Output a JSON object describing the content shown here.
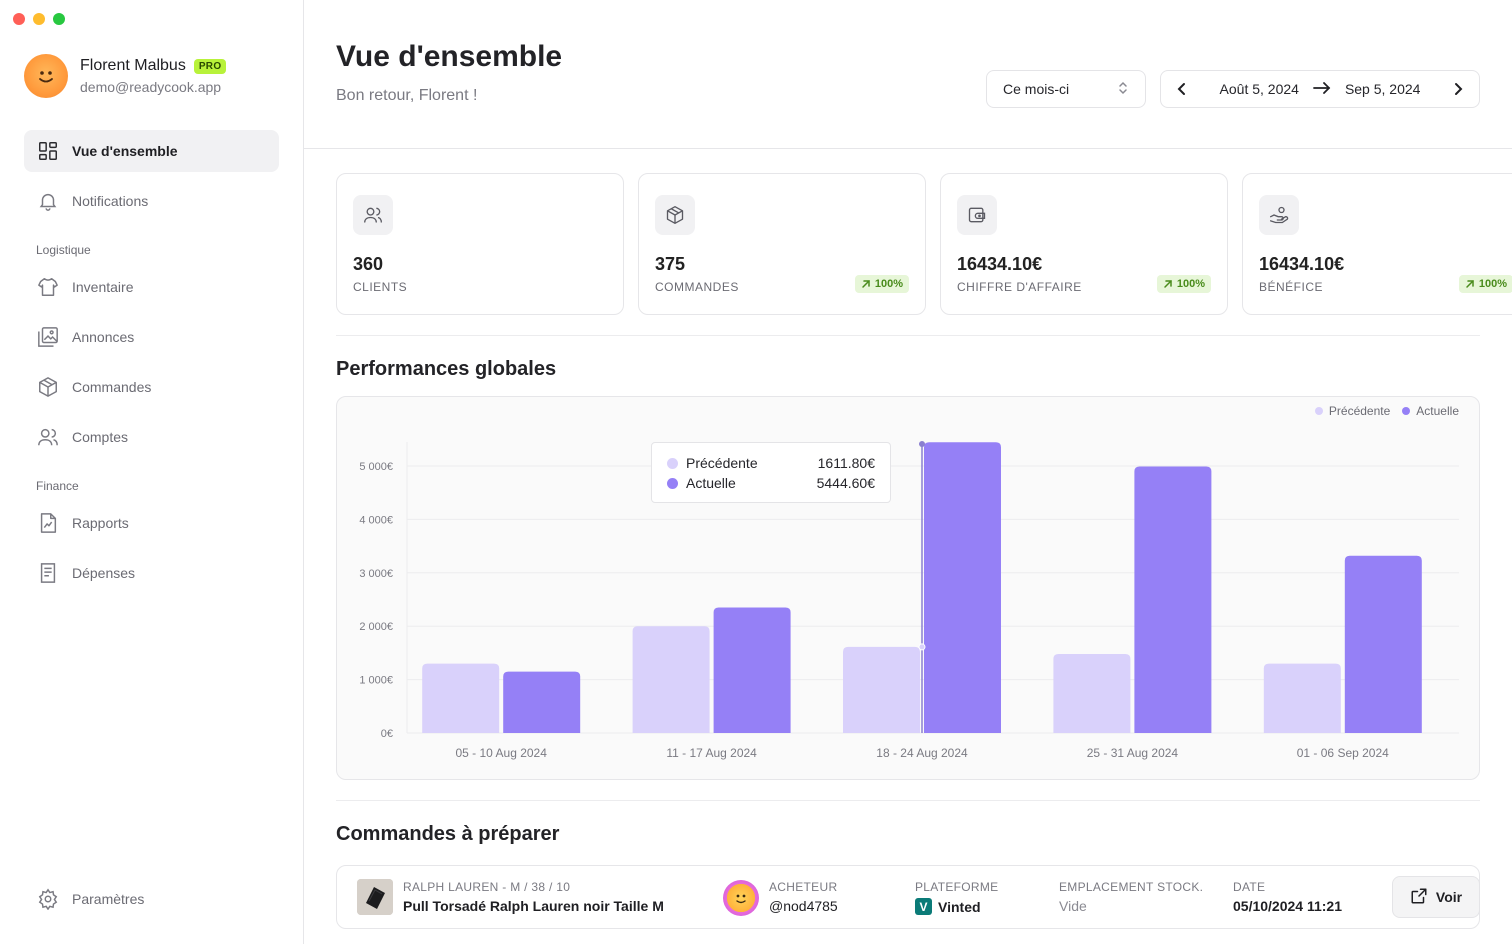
{
  "user": {
    "name": "Florent Malbus",
    "badge": "PRO",
    "email": "demo@readycook.app"
  },
  "sidebar": {
    "main_items": [
      {
        "label": "Vue d'ensemble",
        "icon": "grid-icon",
        "active": true
      },
      {
        "label": "Notifications",
        "icon": "bell-icon"
      }
    ],
    "logistique_label": "Logistique",
    "logistique_items": [
      {
        "label": "Inventaire",
        "icon": "shirt-icon"
      },
      {
        "label": "Annonces",
        "icon": "images-icon"
      },
      {
        "label": "Commandes",
        "icon": "box-icon"
      },
      {
        "label": "Comptes",
        "icon": "users-icon"
      }
    ],
    "finance_label": "Finance",
    "finance_items": [
      {
        "label": "Rapports",
        "icon": "report-icon"
      },
      {
        "label": "Dépenses",
        "icon": "receipt-icon"
      }
    ],
    "settings": {
      "label": "Paramètres",
      "icon": "gear-icon"
    }
  },
  "header": {
    "title": "Vue d'ensemble",
    "subtitle": "Bon retour, Florent !",
    "period_select": "Ce mois-ci",
    "date_start": "Août 5, 2024",
    "date_end": "Sep 5, 2024"
  },
  "stats": [
    {
      "value": "360",
      "label": "CLIENTS",
      "icon": "users-icon",
      "delta": ""
    },
    {
      "value": "375",
      "label": "COMMANDES",
      "icon": "box-icon",
      "delta": "100%"
    },
    {
      "value": "16434.10€",
      "label": "CHIFFRE D'AFFAIRE",
      "icon": "wallet-icon",
      "delta": "100%"
    },
    {
      "value": "16434.10€",
      "label": "BÉNÉFICE",
      "icon": "hand-coin-icon",
      "delta": "100%"
    }
  ],
  "performance": {
    "title": "Performances globales",
    "legend": {
      "previous": "Précédente",
      "current": "Actuelle"
    },
    "tooltip": {
      "previous_label": "Précédente",
      "previous_value": "1611.80€",
      "current_label": "Actuelle",
      "current_value": "5444.60€"
    }
  },
  "chart_data": {
    "type": "bar",
    "categories": [
      "05 - 10 Aug 2024",
      "11 - 17 Aug 2024",
      "18 - 24 Aug 2024",
      "25 - 31 Aug 2024",
      "01 - 06 Sep 2024"
    ],
    "series": [
      {
        "name": "Précédente",
        "values": [
          1300,
          2000,
          1611.8,
          1480,
          1300
        ],
        "color": "#d9d1fb"
      },
      {
        "name": "Actuelle",
        "values": [
          1150,
          2350,
          5444.6,
          4990,
          3320
        ],
        "color": "#9580f6"
      }
    ],
    "ytick_labels": [
      "0€",
      "1 000€",
      "2 000€",
      "3 000€",
      "4 000€",
      "5 000€"
    ],
    "yticks": [
      0,
      1000,
      2000,
      3000,
      4000,
      5000
    ],
    "ylim": [
      0,
      5000
    ],
    "grid": true,
    "legend_position": "top-right",
    "highlighted_category_index": 2
  },
  "orders": {
    "title": "Commandes à préparer",
    "items": [
      {
        "brand_size": "RALPH LAUREN - M / 38 / 10",
        "product": "Pull Torsadé Ralph Lauren noir Taille M",
        "buyer_label": "ACHETEUR",
        "buyer": "@nod4785",
        "platform_label": "PLATEFORME",
        "platform": "Vinted",
        "location_label": "EMPLACEMENT STOCK.",
        "location": "Vide",
        "date_label": "DATE",
        "date": "05/10/2024 11:21",
        "action": "Voir"
      }
    ]
  }
}
